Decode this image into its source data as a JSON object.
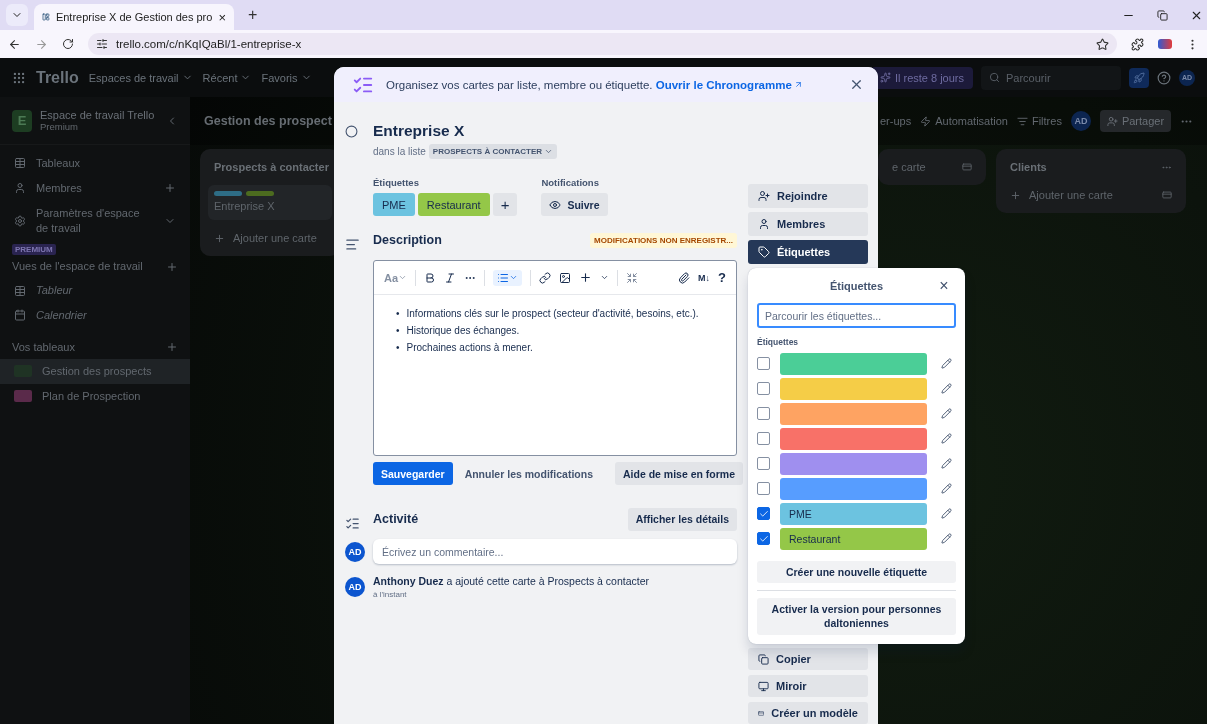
{
  "browser": {
    "tab": {
      "title": "Entreprise X de Gestion des pro",
      "close": "×"
    },
    "new_tab": "+",
    "url": "trello.com/c/nKqIQaBl/1-entreprise-x"
  },
  "header": {
    "logo": "Trello",
    "menus": [
      {
        "label": "Espaces de travail"
      },
      {
        "label": "Récent"
      },
      {
        "label": "Favoris"
      }
    ],
    "trial": "Il reste 8 jours",
    "search": {
      "placeholder": "Parcourir"
    },
    "avatar": "AD"
  },
  "sidebar": {
    "workspace": {
      "initial": "E",
      "name": "Espace de travail Trello",
      "plan": "Premium"
    },
    "items": [
      {
        "label": "Tableaux",
        "kind": "link"
      },
      {
        "label": "Membres",
        "kind": "add"
      },
      {
        "label": "Paramètres d'espace de travail",
        "kind": "expand"
      }
    ],
    "badge": "PREMIUM",
    "views_title": "Vues de l'espace de travail",
    "views": [
      {
        "label": "Tableur"
      },
      {
        "label": "Calendrier"
      }
    ],
    "boards_title": "Vos tableaux",
    "boards": [
      {
        "name": "Gestion des prospects",
        "selected": true,
        "color": "#1f3324"
      },
      {
        "name": "Plan de Prospection",
        "selected": false,
        "color": "#5a2a4a"
      }
    ]
  },
  "board": {
    "title": "Gestion des prospect",
    "tools": [
      "er-ups",
      "Automatisation",
      "Filtres"
    ],
    "avatar": "AD",
    "share": "Partager",
    "lists": [
      {
        "title": "Prospects à contacter",
        "cards": [
          {
            "title": "Entreprise X",
            "labels": [
              {
                "color": "#2e6d86"
              },
              {
                "color": "#4c6b1f"
              }
            ]
          }
        ],
        "add": "Ajouter une carte"
      },
      {
        "add": "e carte"
      },
      {
        "title": "Clients",
        "add": "Ajouter une carte"
      }
    ]
  },
  "modal": {
    "banner": {
      "text": "Organisez vos cartes par liste, membre ou étiquette.",
      "link": "Ouvrir le Chronogramme"
    },
    "title": "Entreprise X",
    "list_prefix": "dans la liste",
    "list_name": "PROSPECTS À CONTACTER",
    "labels_heading": "Étiquettes",
    "labels": [
      {
        "name": "PME",
        "color": "#6cc3e0"
      },
      {
        "name": "Restaurant",
        "color": "#94c748"
      }
    ],
    "add_label": "+",
    "notifications_heading": "Notifications",
    "watch": "Suivre",
    "description_heading": "Description",
    "unsaved": "MODIFICATIONS NON ENREGISTR...",
    "editor": {
      "style": "Aa",
      "markdown": "M↓",
      "help": "?",
      "bullets": [
        {
          "marker": "•",
          "text": "Informations clés sur le prospect (secteur d'activité, besoins, etc.)."
        },
        {
          "marker": "•",
          "text": "Historique des échanges."
        },
        {
          "marker": "•",
          "text": "Prochaines actions à mener."
        }
      ]
    },
    "save": "Sauvegarder",
    "cancel": "Annuler les modifications",
    "format_help": "Aide de mise en forme",
    "activity_heading": "Activité",
    "details": "Afficher les détails",
    "comment": {
      "avatar": "AD",
      "placeholder": "Écrivez un commentaire..."
    },
    "entries": [
      {
        "avatar": "AD",
        "text": "**Anthony Duez** a ajouté cette carte à Prospects à contacter",
        "time": "à l'instant"
      }
    ],
    "actions_top": [
      {
        "label": "Rejoindre",
        "selected": false
      },
      {
        "label": "Membres",
        "selected": false
      },
      {
        "label": "Étiquettes",
        "selected": true
      }
    ],
    "actions_bottom": [
      {
        "label": "Copier"
      },
      {
        "label": "Miroir"
      },
      {
        "label": "Créer un modèle"
      }
    ]
  },
  "popover": {
    "title": "Étiquettes",
    "close": "×",
    "search": {
      "placeholder": "Parcourir les étiquettes..."
    },
    "section": "Étiquettes",
    "labels": [
      {
        "color": "#4bce97",
        "checked": false
      },
      {
        "color": "#f5cd47",
        "checked": false
      },
      {
        "color": "#fea362",
        "checked": false
      },
      {
        "color": "#f87168",
        "checked": false
      },
      {
        "color": "#9f8fef",
        "checked": false
      },
      {
        "color": "#579dff",
        "checked": false
      },
      {
        "color": "#6cc3e0",
        "checked": true,
        "name": "PME"
      },
      {
        "color": "#94c748",
        "checked": true,
        "name": "Restaurant"
      }
    ],
    "create": "Créer une nouvelle étiquette",
    "colorblind": "Activer la version pour personnes daltoniennes"
  }
}
